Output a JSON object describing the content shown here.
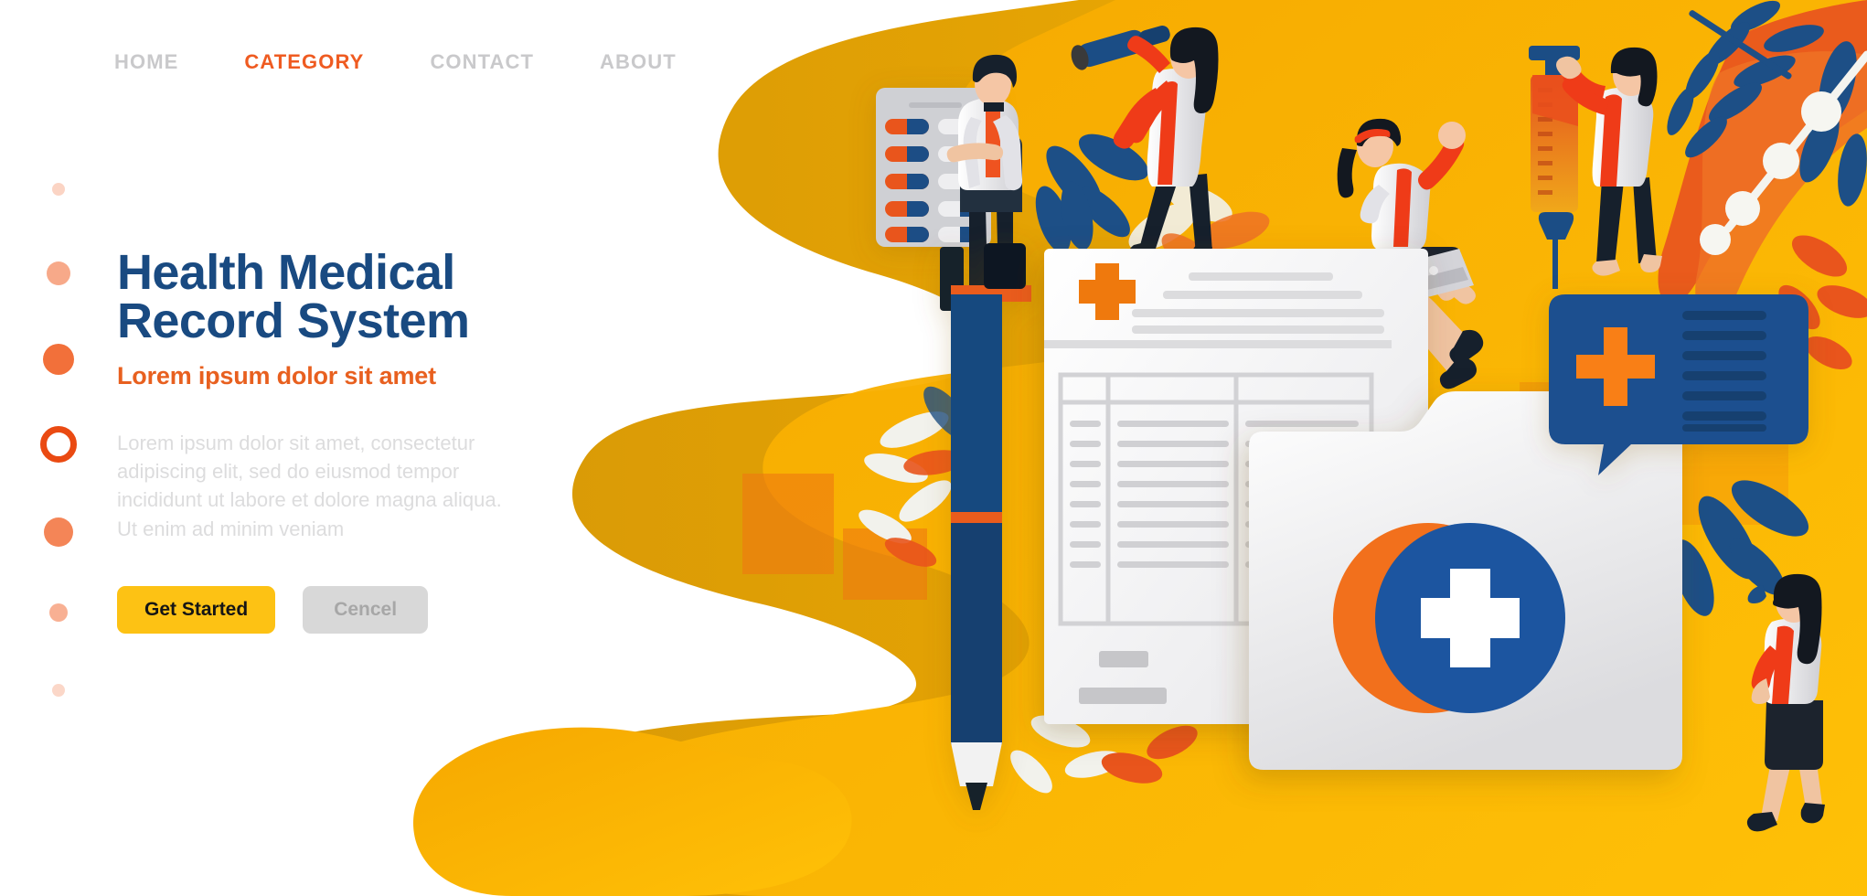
{
  "nav": {
    "items": [
      {
        "label": "HOME",
        "active": false
      },
      {
        "label": "CATEGORY",
        "active": true
      },
      {
        "label": "CONTACT",
        "active": false
      },
      {
        "label": "ABOUT",
        "active": false
      }
    ]
  },
  "hero": {
    "headline_line1": "Health Medical",
    "headline_line2": "Record System",
    "subheadline": "Lorem ipsum dolor sit amet",
    "body": "Lorem ipsum dolor sit amet, consectetur adipiscing elit, sed do eiusmod tempor incididunt ut labore et dolore magna aliqua. Ut enim ad minim veniam",
    "primary_button": "Get Started",
    "secondary_button": "Cencel"
  },
  "dots": {
    "count": 7,
    "active_index": 3,
    "items": [
      {
        "size": 14,
        "opacity": 0.3
      },
      {
        "size": 26,
        "opacity": 0.6
      },
      {
        "size": 34,
        "opacity": 1.0
      },
      {
        "size": 40,
        "opacity": 1.0,
        "ring": true
      },
      {
        "size": 32,
        "opacity": 0.85
      },
      {
        "size": 20,
        "opacity": 0.55
      },
      {
        "size": 14,
        "opacity": 0.28
      }
    ]
  },
  "colors": {
    "brand_orange": "#ef5b21",
    "brand_blue": "#194a81",
    "accent_yellow": "#fdc214",
    "background_yellow": "#f9b200",
    "deep_orange": "#e8601f",
    "muted_grey": "#dcdcdd",
    "nav_grey": "#c9c9cb",
    "white": "#ffffff",
    "dark_navy": "#1b3a5c",
    "pen_blue": "#13487f",
    "cross_white": "#ffffff",
    "paper_white": "#f7f7f8",
    "paper_line": "#d4d4d6",
    "hair_black": "#131820",
    "skin": "#f5c6a5",
    "coat_white": "#e9e9ec",
    "shirt_orange": "#ef5320"
  },
  "illustration": {
    "scene_name": "health-medical-record-system-illustration",
    "elements": [
      {
        "name": "yellow-blob-background"
      },
      {
        "name": "pill-blister-pack"
      },
      {
        "name": "doctor-with-pills"
      },
      {
        "name": "woman-with-telescope"
      },
      {
        "name": "woman-with-laptop"
      },
      {
        "name": "nurse-with-syringe"
      },
      {
        "name": "blue-pen"
      },
      {
        "name": "medical-form-document"
      },
      {
        "name": "medical-folder"
      },
      {
        "name": "blue-medical-card"
      },
      {
        "name": "medical-cross-logo"
      },
      {
        "name": "woman-walking"
      },
      {
        "name": "foliage-decoration"
      }
    ],
    "document": {
      "table_rows": 8,
      "table_columns": 3,
      "header_lines": 5,
      "footer_blocks": 2
    },
    "blue_card": {
      "text_lines": 7
    },
    "blister_pack": {
      "rows": 5,
      "columns": 2
    }
  }
}
